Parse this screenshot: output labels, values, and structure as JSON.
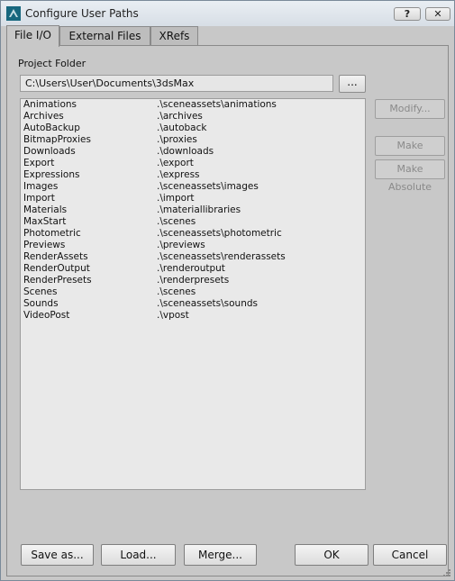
{
  "window": {
    "title": "Configure User Paths",
    "help_label": "?",
    "close_label": "✕"
  },
  "tabs": [
    {
      "label": "File I/O",
      "active": true
    },
    {
      "label": "External Files",
      "active": false
    },
    {
      "label": "XRefs",
      "active": false
    }
  ],
  "project": {
    "label": "Project Folder",
    "value": "C:\\Users\\User\\Documents\\3dsMax",
    "browse_label": "..."
  },
  "paths": [
    {
      "name": "Animations",
      "path": ".\\sceneassets\\animations"
    },
    {
      "name": "Archives",
      "path": ".\\archives"
    },
    {
      "name": "AutoBackup",
      "path": ".\\autoback"
    },
    {
      "name": "BitmapProxies",
      "path": ".\\proxies"
    },
    {
      "name": "Downloads",
      "path": ".\\downloads"
    },
    {
      "name": "Export",
      "path": ".\\export"
    },
    {
      "name": "Expressions",
      "path": ".\\express"
    },
    {
      "name": "Images",
      "path": ".\\sceneassets\\images"
    },
    {
      "name": "Import",
      "path": ".\\import"
    },
    {
      "name": "Materials",
      "path": ".\\materiallibraries"
    },
    {
      "name": "MaxStart",
      "path": ".\\scenes"
    },
    {
      "name": "Photometric",
      "path": ".\\sceneassets\\photometric"
    },
    {
      "name": "Previews",
      "path": ".\\previews"
    },
    {
      "name": "RenderAssets",
      "path": ".\\sceneassets\\renderassets"
    },
    {
      "name": "RenderOutput",
      "path": ".\\renderoutput"
    },
    {
      "name": "RenderPresets",
      "path": ".\\renderpresets"
    },
    {
      "name": "Scenes",
      "path": ".\\scenes"
    },
    {
      "name": "Sounds",
      "path": ".\\sceneassets\\sounds"
    },
    {
      "name": "VideoPost",
      "path": ".\\vpost"
    }
  ],
  "side_buttons": {
    "modify": "Modify...",
    "make_relative": "Make Relative",
    "make_absolute": "Make Absolute"
  },
  "bottom_buttons": {
    "save_as": "Save as...",
    "load": "Load...",
    "merge": "Merge...",
    "ok": "OK",
    "cancel": "Cancel"
  },
  "icons": {
    "app": "3dsmax-app-icon",
    "resize": "resize-grip-icon"
  }
}
